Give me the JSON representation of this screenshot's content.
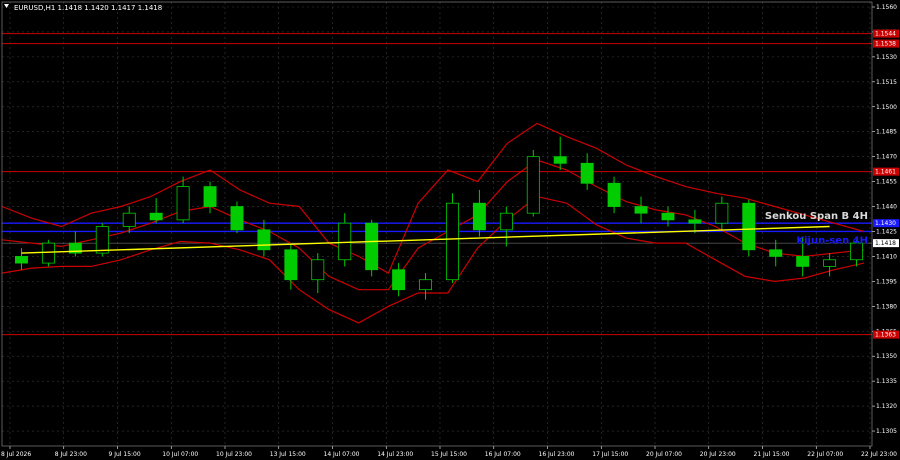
{
  "chart_data": {
    "type": "candlestick",
    "title": "EURUSD,H1  1.1418 1.1420 1.1417 1.1418",
    "ylim": [
      1.1296,
      1.1563
    ],
    "y_ticks": [
      "1.1560",
      "1.1545",
      "1.1530",
      "1.1515",
      "1.1500",
      "1.1485",
      "1.1470",
      "1.1455",
      "1.1440",
      "1.1425",
      "1.1410",
      "1.1395",
      "1.1380",
      "1.1365",
      "1.1350",
      "1.1335",
      "1.1320",
      "1.1305"
    ],
    "x_ticks": [
      "8 Jul 2026",
      "8 Jul 23:00",
      "9 Jul 15:00",
      "10 Jul 07:00",
      "10 Jul 23:00",
      "13 Jul 15:00",
      "14 Jul 07:00",
      "14 Jul 23:00",
      "15 Jul 15:00",
      "16 Jul 07:00",
      "16 Jul 23:00",
      "17 Jul 15:00",
      "20 Jul 07:00",
      "20 Jul 23:00",
      "21 Jul 15:00",
      "22 Jul 07:00",
      "22 Jul 23:00"
    ],
    "levels": [
      {
        "price": 1.1544,
        "label": "1.1544",
        "color": "#cc0000"
      },
      {
        "price": 1.1538,
        "label": "1.1538",
        "color": "#cc0000"
      },
      {
        "price": 1.1461,
        "label": "1.1461",
        "color": "#cc0000"
      },
      {
        "price": 1.1363,
        "label": "1.1363",
        "color": "#cc0000"
      },
      {
        "price": 1.143,
        "label": "1.1430",
        "color": "#1a1aff",
        "name": "Senkou Span B 4H",
        "name_color": "#d9d9d9"
      },
      {
        "price": 1.1425,
        "label": "",
        "color": "#1a1aff",
        "name": "Kijun-sen 4H",
        "name_color": "#1a1aff"
      }
    ],
    "current_price": {
      "price": 1.1418,
      "label": "1.1418"
    },
    "trendline": {
      "from": {
        "bar": 0,
        "price": 1.1412
      },
      "to": {
        "bar": 30,
        "price": 1.1428
      },
      "color": "#ffff00"
    },
    "bollinger": {
      "color": "#cc0000",
      "upper": [
        1.144,
        1.1433,
        1.1428,
        1.1436,
        1.144,
        1.1446,
        1.1455,
        1.1462,
        1.145,
        1.1442,
        1.144,
        1.1418,
        1.141,
        1.14,
        1.1442,
        1.1462,
        1.1455,
        1.1478,
        1.149,
        1.1482,
        1.1475,
        1.1465,
        1.1458,
        1.1452,
        1.1448,
        1.1445,
        1.144,
        1.1435,
        1.143,
        1.1425
      ],
      "middle": [
        1.142,
        1.1418,
        1.1416,
        1.142,
        1.1424,
        1.143,
        1.1437,
        1.144,
        1.1432,
        1.1425,
        1.1415,
        1.1398,
        1.139,
        1.139,
        1.1415,
        1.1425,
        1.1435,
        1.1455,
        1.1468,
        1.1462,
        1.1452,
        1.1443,
        1.1438,
        1.1435,
        1.1428,
        1.1418,
        1.1412,
        1.141,
        1.1412,
        1.1414
      ],
      "lower": [
        1.14,
        1.1403,
        1.1404,
        1.1404,
        1.1408,
        1.1414,
        1.1419,
        1.1418,
        1.1414,
        1.1408,
        1.139,
        1.1378,
        1.137,
        1.138,
        1.1388,
        1.1388,
        1.1415,
        1.1432,
        1.1446,
        1.1442,
        1.1429,
        1.1421,
        1.1418,
        1.1418,
        1.1408,
        1.1398,
        1.1395,
        1.1397,
        1.1402,
        1.1406
      ]
    },
    "candles": [
      [
        1.141,
        1.1415,
        1.1402,
        1.1406
      ],
      [
        1.1406,
        1.142,
        1.1404,
        1.1418
      ],
      [
        1.1418,
        1.1425,
        1.141,
        1.1412
      ],
      [
        1.1412,
        1.143,
        1.141,
        1.1428
      ],
      [
        1.1428,
        1.144,
        1.1424,
        1.1436
      ],
      [
        1.1436,
        1.1445,
        1.143,
        1.1432
      ],
      [
        1.1432,
        1.1458,
        1.143,
        1.1452
      ],
      [
        1.1452,
        1.1455,
        1.1436,
        1.144
      ],
      [
        1.144,
        1.1443,
        1.1424,
        1.1426
      ],
      [
        1.1426,
        1.1432,
        1.141,
        1.1414
      ],
      [
        1.1414,
        1.1418,
        1.139,
        1.1396
      ],
      [
        1.1396,
        1.1412,
        1.1388,
        1.1408
      ],
      [
        1.1408,
        1.1436,
        1.1404,
        1.143
      ],
      [
        1.143,
        1.1432,
        1.1398,
        1.1402
      ],
      [
        1.1402,
        1.1406,
        1.1386,
        1.139
      ],
      [
        1.139,
        1.14,
        1.1384,
        1.1396
      ],
      [
        1.1396,
        1.1448,
        1.1394,
        1.1442
      ],
      [
        1.1442,
        1.145,
        1.1422,
        1.1426
      ],
      [
        1.1426,
        1.144,
        1.1416,
        1.1436
      ],
      [
        1.1436,
        1.1474,
        1.1434,
        1.147
      ],
      [
        1.147,
        1.1482,
        1.1462,
        1.1466
      ],
      [
        1.1466,
        1.1472,
        1.145,
        1.1454
      ],
      [
        1.1454,
        1.1458,
        1.1436,
        1.144
      ],
      [
        1.144,
        1.1446,
        1.143,
        1.1436
      ],
      [
        1.1436,
        1.144,
        1.1428,
        1.1432
      ],
      [
        1.1432,
        1.1438,
        1.1424,
        1.143
      ],
      [
        1.143,
        1.1446,
        1.1426,
        1.1442
      ],
      [
        1.1442,
        1.1444,
        1.141,
        1.1414
      ],
      [
        1.1414,
        1.142,
        1.1404,
        1.141
      ],
      [
        1.141,
        1.1422,
        1.1398,
        1.1404
      ],
      [
        1.1404,
        1.1412,
        1.1398,
        1.1408
      ],
      [
        1.1408,
        1.142,
        1.1404,
        1.1418
      ]
    ]
  }
}
